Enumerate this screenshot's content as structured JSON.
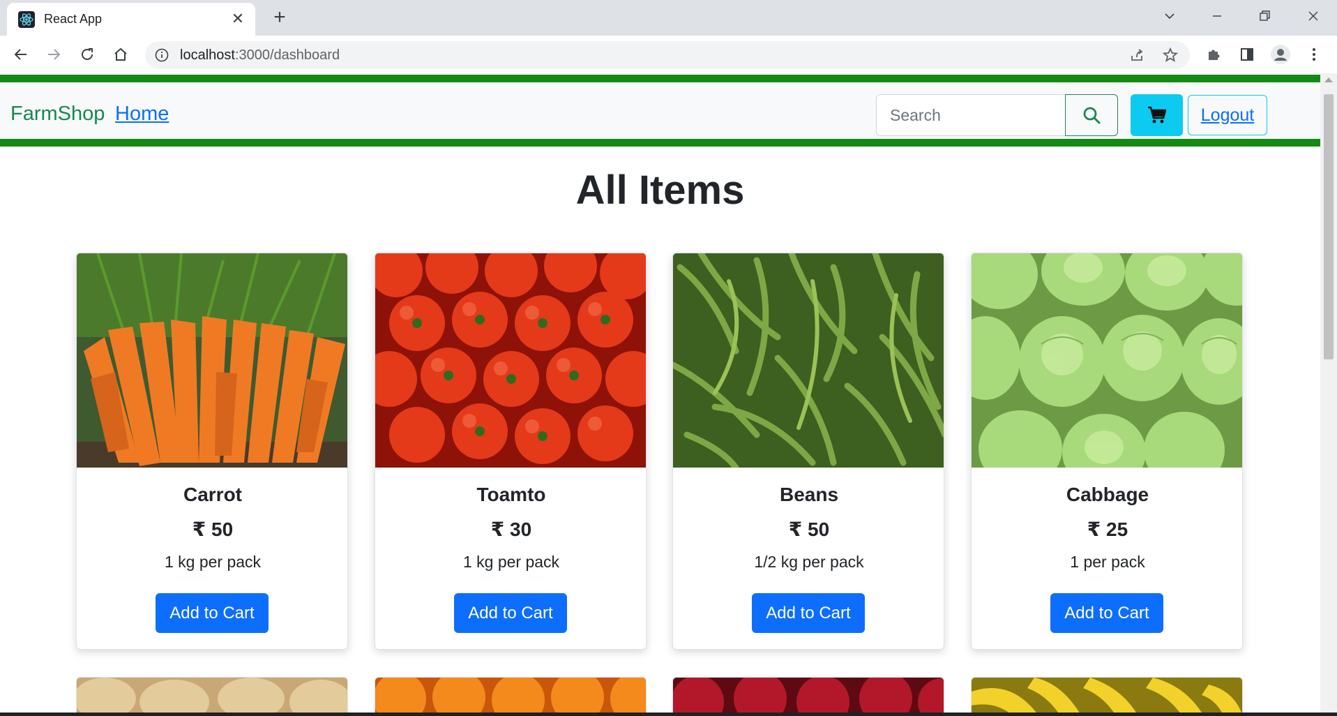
{
  "browser": {
    "tab_title": "React App",
    "url_host": "localhost",
    "url_path": ":3000/dashboard"
  },
  "nav": {
    "brand": "FarmShop",
    "home": "Home",
    "search_placeholder": "Search",
    "logout": "Logout"
  },
  "page": {
    "title": "All Items"
  },
  "products": [
    {
      "name": "Carrot",
      "price": "₹ 50",
      "unit": "1 kg per pack",
      "button": "Add to Cart"
    },
    {
      "name": "Toamto",
      "price": "₹ 30",
      "unit": "1 kg per pack",
      "button": "Add to Cart"
    },
    {
      "name": "Beans",
      "price": "₹ 50",
      "unit": "1/2 kg per pack",
      "button": "Add to Cart"
    },
    {
      "name": "Cabbage",
      "price": "₹ 25",
      "unit": "1 per pack",
      "button": "Add to Cart"
    }
  ],
  "colors": {
    "brand_green": "#198754",
    "nav_border": "#138a13",
    "primary": "#0d6efd",
    "info": "#0dcaf0"
  }
}
